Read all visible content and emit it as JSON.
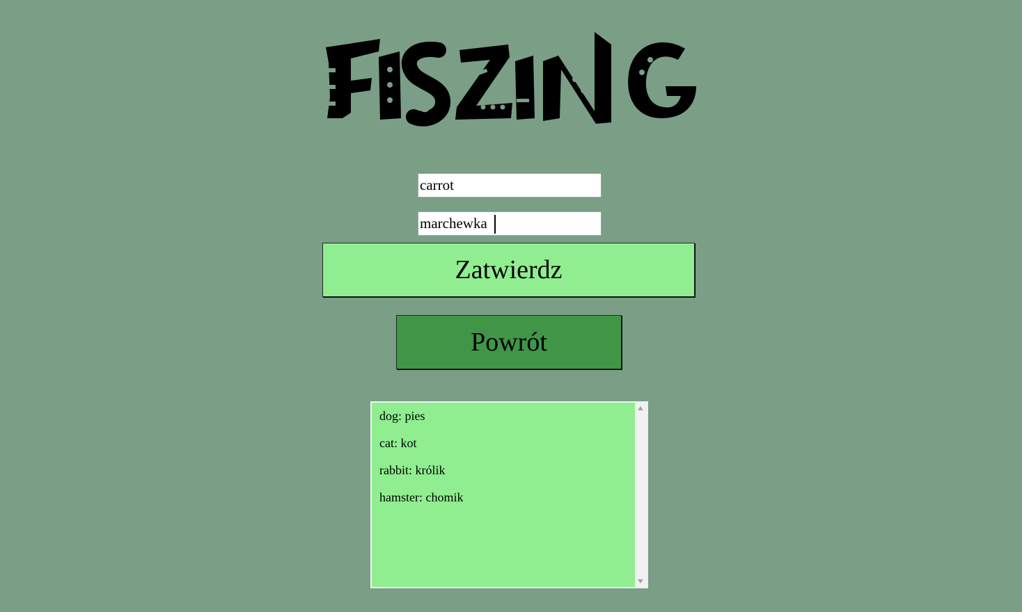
{
  "app": {
    "logo_text": "FISZING"
  },
  "form": {
    "english_value": "carrot",
    "polish_value": "marchewka"
  },
  "buttons": {
    "confirm_label": "Zatwierdz",
    "back_label": "Powrót"
  },
  "word_list": [
    {
      "text": "dog: pies"
    },
    {
      "text": "cat: kot"
    },
    {
      "text": "rabbit: królik"
    },
    {
      "text": "hamster: chomik"
    }
  ],
  "colors": {
    "background": "#7a9e86",
    "confirm_button": "#90ee90",
    "back_button": "#409646",
    "list_background": "#90ee90"
  }
}
